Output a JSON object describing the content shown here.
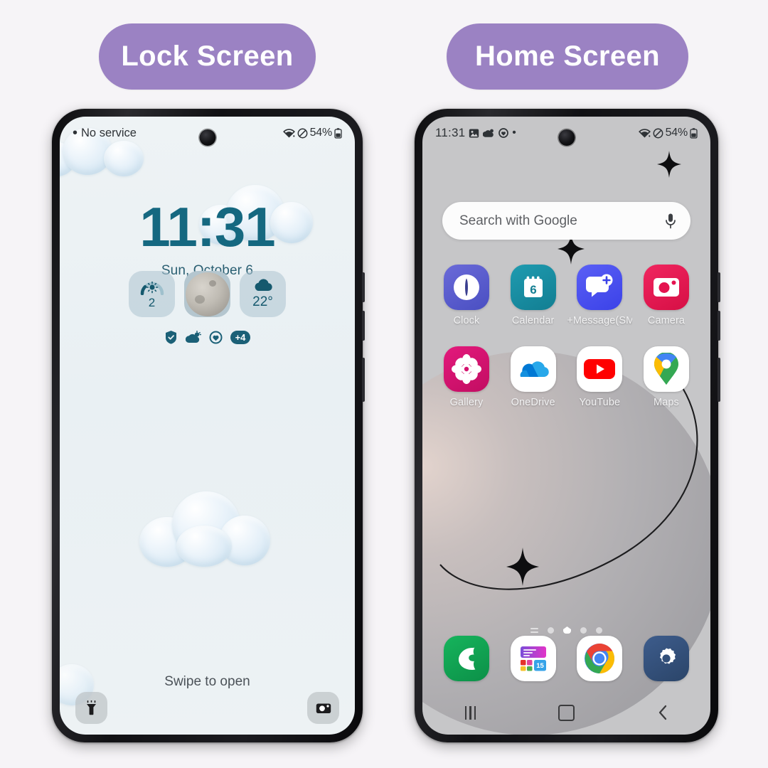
{
  "labels": {
    "lock": "Lock Screen",
    "home": "Home Screen",
    "pill_color": "#9b82c3",
    "page_background": "#f6f4f7"
  },
  "lock_screen": {
    "status_bar": {
      "carrier": "No service",
      "carrier_dot": "•",
      "battery": "54%",
      "icons": [
        "wifi-icon",
        "do-not-disturb-icon",
        "battery-icon"
      ]
    },
    "clock": {
      "time": "11:31",
      "date": "Sun, October 6",
      "color": "#156880"
    },
    "widgets": [
      {
        "name": "uv-index-widget",
        "icon": "sun-gauge-icon",
        "value": "2"
      },
      {
        "name": "moon-phase-widget",
        "icon": "moon-icon",
        "value": ""
      },
      {
        "name": "weather-widget",
        "icon": "cloud-icon",
        "value": "22°"
      }
    ],
    "notification_icons": [
      {
        "name": "shield-icon",
        "label": ""
      },
      {
        "name": "weather-icon",
        "label": ""
      },
      {
        "name": "health-icon",
        "label": ""
      },
      {
        "name": "more-notifications-badge",
        "label": "+4"
      }
    ],
    "swipe_hint": "Swipe to open",
    "shortcuts": [
      {
        "name": "flashlight-shortcut",
        "icon": "flashlight-icon"
      },
      {
        "name": "camera-shortcut",
        "icon": "camera-icon"
      }
    ],
    "wallpaper": "pale blue glossy clouds"
  },
  "home_screen": {
    "status_bar": {
      "time": "11:31",
      "battery": "54%",
      "left_icons": [
        "image-icon",
        "weather-icon",
        "health-icon",
        "dot-icon"
      ],
      "right_icons": [
        "wifi-icon",
        "do-not-disturb-icon",
        "battery-icon"
      ]
    },
    "search": {
      "placeholder": "Search with Google",
      "mic_icon": "microphone-icon"
    },
    "apps": [
      [
        {
          "label": "Clock",
          "icon": "clock-icon",
          "color": "#5b5fd1"
        },
        {
          "label": "Calendar",
          "icon": "calendar-icon",
          "color": "#1a8ca0",
          "badge": "6"
        },
        {
          "label": "+Message(SM...",
          "icon": "message-icon",
          "color": "#4455ee"
        },
        {
          "label": "Camera",
          "icon": "camera-icon",
          "color": "#e4134f"
        }
      ],
      [
        {
          "label": "Gallery",
          "icon": "gallery-icon",
          "color": "#d4126e"
        },
        {
          "label": "OneDrive",
          "icon": "onedrive-icon",
          "color": "#ffffff"
        },
        {
          "label": "YouTube",
          "icon": "youtube-icon",
          "color": "#ffffff"
        },
        {
          "label": "Maps",
          "icon": "maps-icon",
          "color": "#ffffff"
        }
      ]
    ],
    "page_indicator": {
      "pages": 5,
      "active": 3,
      "leading_icon": "pages-list-icon"
    },
    "dock": [
      {
        "label": "",
        "icon": "phone-icon",
        "color": "#11a052"
      },
      {
        "label": "",
        "icon": "widgets-icon",
        "color": "#ffffff",
        "badge": "15"
      },
      {
        "label": "",
        "icon": "chrome-icon",
        "color": "#ffffff"
      },
      {
        "label": "",
        "icon": "settings-icon",
        "color": "#33507a"
      }
    ],
    "nav_bar": [
      {
        "name": "recents-button",
        "icon": "recents-icon"
      },
      {
        "name": "home-button",
        "icon": "home-icon"
      },
      {
        "name": "back-button",
        "icon": "back-icon"
      }
    ],
    "wallpaper": "grey gradient planet with orbit ring and black sparkles"
  }
}
